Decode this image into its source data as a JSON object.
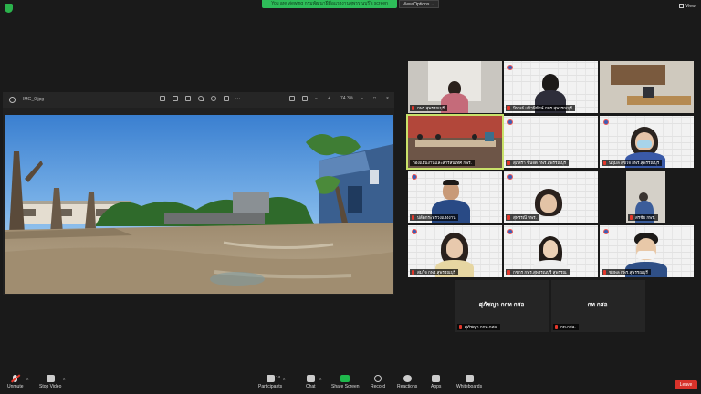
{
  "top": {
    "share_banner": "You are viewing กรมพัฒนาฝีมือแรงงานสุพรรณบุรี's screen",
    "view_options": "View Options ⌄",
    "view_label": "View"
  },
  "viewer": {
    "filename": "IMG_0.jpg",
    "zoom_value": "74.3%"
  },
  "gallery": {
    "tiles": [
      {
        "name": "กพร.สุพรรณบุรี"
      },
      {
        "name": "นิพนธ์ แก้วพิทักษ์ กพร.สุพรรณบุรี"
      },
      {
        "name": ""
      },
      {
        "name": "กองแผนงานและสารสนเทศ กพร."
      },
      {
        "name": "สุภิสรา ชื่นจิต กพร.สุพรรณบุรี"
      },
      {
        "name": "นฤมล สุขใจ กพร.สุพรรณบุรี"
      },
      {
        "name": "ปลัดกระทรวงแรงงาน"
      },
      {
        "name": "สุพรรณี กพร."
      },
      {
        "name": "สรชัย กพร."
      },
      {
        "name": "สมใจ กพร.สุพรรณบุรี"
      },
      {
        "name": "กชกร กพร.สุพรรณบุรี สุพรรณ"
      },
      {
        "name": "ชยพล กพร.สุพรรณบุรี"
      }
    ],
    "black_tiles": [
      {
        "big": "ศุภัชญา กกท.กสอ.",
        "small": "ศุภัชญา กกท.กสอ."
      },
      {
        "big": "กท.กสอ.",
        "small": "กท.กสอ."
      }
    ]
  },
  "toolbar": {
    "unmute": "Unmute",
    "stop_video": "Stop Video",
    "participants": "Participants",
    "participants_count": "14",
    "chat": "Chat",
    "share_screen": "Share Screen",
    "record": "Record",
    "reactions": "Reactions",
    "apps": "Apps",
    "whiteboards": "Whiteboards",
    "leave": "Leave"
  }
}
